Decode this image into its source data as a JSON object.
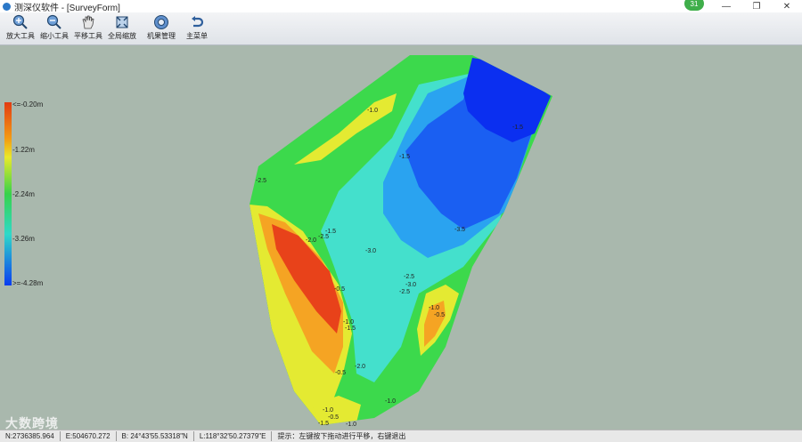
{
  "window": {
    "title": "测深仪软件 - [SurveyForm]",
    "notification_count": "31",
    "controls": {
      "minimize": "—",
      "restore": "❐",
      "close": "✕"
    }
  },
  "toolbar": {
    "tools": [
      {
        "label": "放大工具",
        "icon": "zoom-in-icon"
      },
      {
        "label": "缩小工具",
        "icon": "zoom-out-icon"
      },
      {
        "label": "平移工具",
        "icon": "pan-hand-icon"
      },
      {
        "label": "全局缩放",
        "icon": "full-extent-icon"
      },
      {
        "label": "机果管理",
        "icon": "gear-icon"
      },
      {
        "label": "主菜单",
        "icon": "undo-icon"
      }
    ]
  },
  "legend": {
    "labels": [
      "<=-0.20m",
      "-1.22m",
      "-2.24m",
      "-3.26m",
      ">=-4.28m"
    ]
  },
  "map": {
    "contour_labels": [
      "-1.0",
      "-1.5",
      "-1.5",
      "-2.5",
      "-1.5",
      "-2.0",
      "-2.5",
      "-3.0",
      "-3.5",
      "-2.5",
      "-3.0",
      "-2.5",
      "-0.5",
      "-1.0",
      "-1.5",
      "-1.0",
      "-0.5",
      "-2.0",
      "-0.5",
      "-1.0",
      "-1.0",
      "-0.5",
      "-1.0",
      "-1.5"
    ],
    "colors": {
      "background": "#a9b8ad",
      "shallow": "#e8421a",
      "orange": "#f5a423",
      "yellow": "#e4ea32",
      "green": "#3cd94c",
      "cyan": "#44e0cc",
      "light_blue": "#2aa3f0",
      "blue": "#1a5ff2",
      "deep": "#0b2ff0"
    }
  },
  "statusbar": {
    "north": "N:2736385.964",
    "east": "E:504670.272",
    "lat": "B: 24°43'55.53318\"N",
    "lon": "L:118°32'50.27379\"E",
    "hint": "提示：左键按下拖动进行平移，右键退出"
  },
  "watermark": "大数跨境"
}
